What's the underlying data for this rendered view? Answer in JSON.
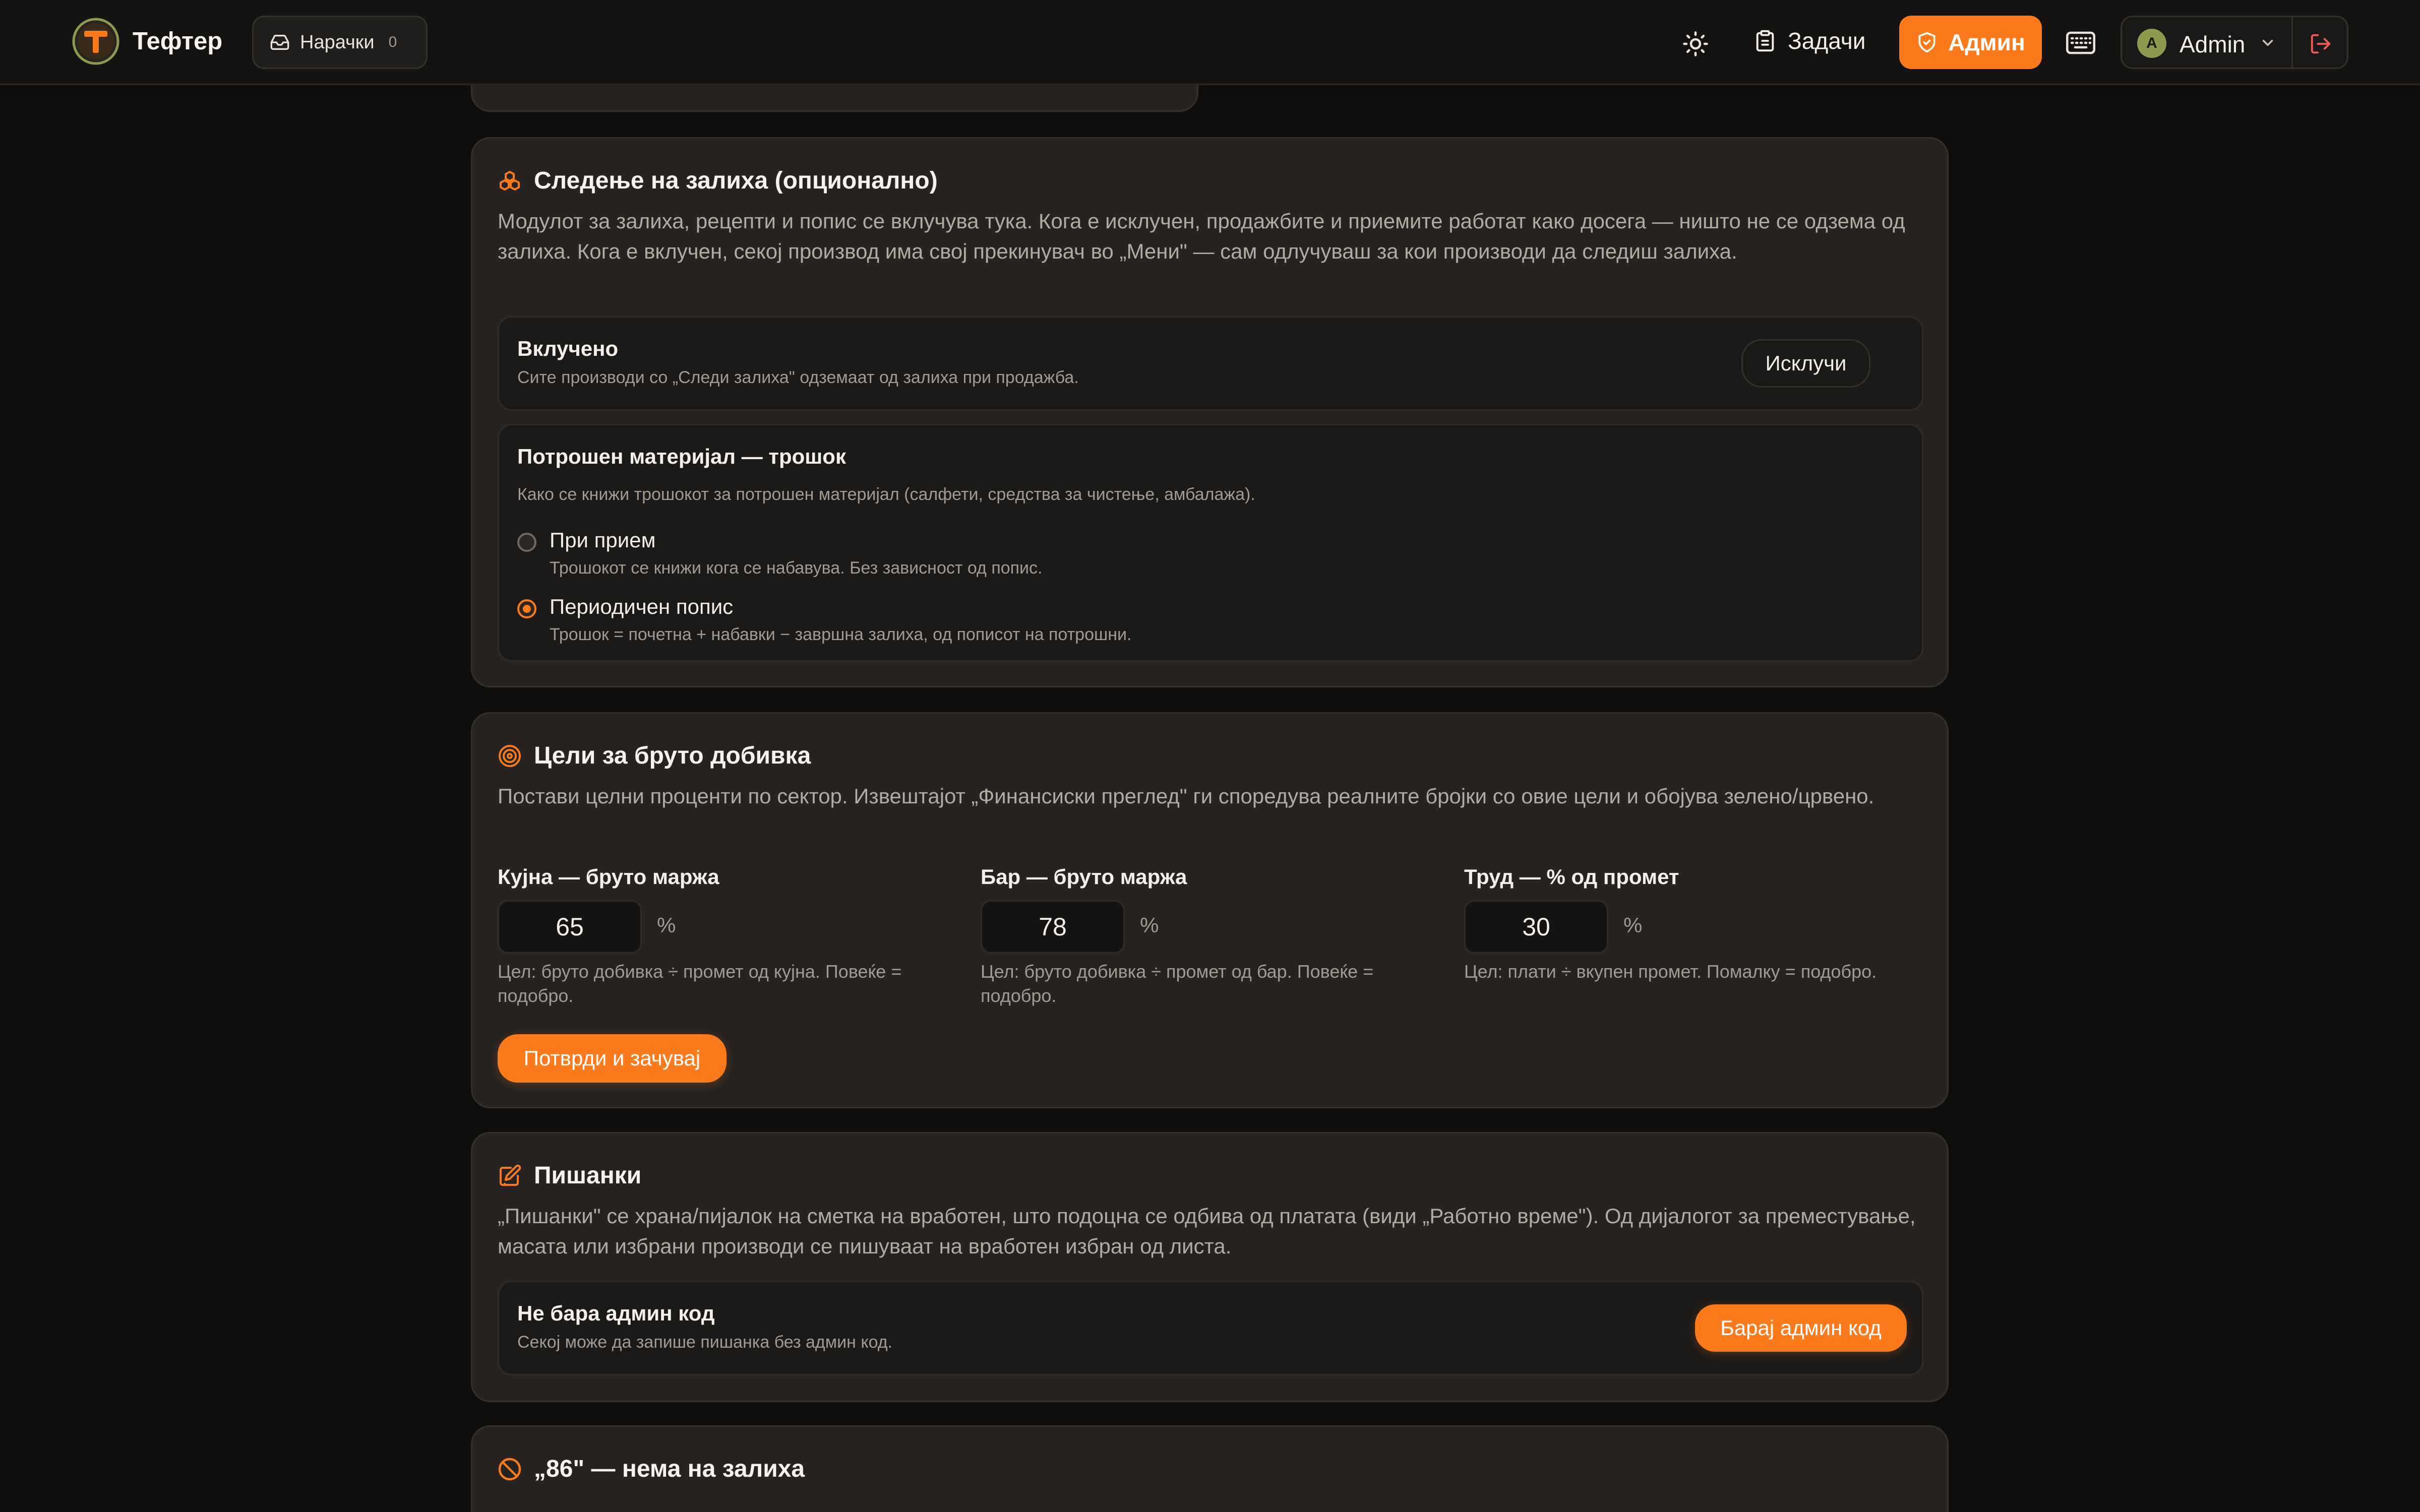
{
  "colors": {
    "accent": "#fb7a1c",
    "background": "#0f0e0d",
    "card": "#262320"
  },
  "header": {
    "brand": "Тефтер",
    "orders": {
      "label": "Нарачки",
      "count": "0",
      "icon": "inbox-icon"
    },
    "theme_icon": "sun-icon",
    "tasks": {
      "label": "Задачи",
      "icon": "clipboard-icon"
    },
    "admin": {
      "label": "Админ",
      "icon": "shield-icon"
    },
    "keyboard_icon": "keyboard-icon",
    "user": {
      "initial": "A",
      "name": "Admin"
    },
    "logout_icon": "logout-icon"
  },
  "stock": {
    "title": "Следење на залиха (опционално)",
    "icon": "boxes-icon",
    "description": "Модулот за залиха, рецепти и попис се вклучува тука. Кога е исклучен, продажбите и приемите работат како досега — ништо не се одзема од залиха. Кога е вклучен, секој производ има свој прекинувач во „Мени\" — сам одлучуваш за кои производи да следиш залиха.",
    "enabled": {
      "title": "Вклучено",
      "description": "Сите производи со „Следи залиха\" одземаат од залиха при продажба.",
      "button": "Исклучи"
    },
    "consumables": {
      "title": "Потрошен материјал — трошок",
      "description": "Како се книжи трошокот за потрошен материјал (салфети, средства за чистење, амбалажа).",
      "options": [
        {
          "label": "При прием",
          "description": "Трошокот се книжи кога се набавува. Без зависност од попис.",
          "selected": false
        },
        {
          "label": "Периодичен попис",
          "description": "Трошок = почетна + набавки − завршна залиха, од пописот на потрошни.",
          "selected": true
        }
      ]
    }
  },
  "targets": {
    "title": "Цели за бруто добивка",
    "icon": "target-icon",
    "description": "Постави целни проценти по сектор. Извештајот „Финансиски преглед\" ги споредува реалните бројки со овие цели и обојува зелено/црвено.",
    "fields": [
      {
        "label": "Кујна — бруто маржа",
        "value": "65",
        "unit": "%",
        "hint": "Цел: бруто добивка ÷ промет од кујна. Повеќе = подобро."
      },
      {
        "label": "Бар — бруто маржа",
        "value": "78",
        "unit": "%",
        "hint": "Цел: бруто добивка ÷ промет од бар. Повеќе = подобро."
      },
      {
        "label": "Труд — % од промет",
        "value": "30",
        "unit": "%",
        "hint": "Цел: плати ÷ вкупен промет. Помалку = подобро."
      }
    ],
    "save_button": "Потврди и зачувај"
  },
  "tabs": {
    "title": "Пишанки",
    "icon": "edit-note-icon",
    "description": "„Пишанки\" се храна/пијалок на сметка на вработен, што подоцна се одбива од платата (види „Работно време\"). Од дијалогот за преместување, масата или избрани производи се пишуваат на вработен избран од листа.",
    "setting": {
      "title": "Не бара админ код",
      "description": "Секој може да запише пишанка без админ код.",
      "button": "Барај админ код"
    },
    "threshold": "0.82"
  },
  "eighty_six": {
    "title": "„86\" — нема на залиха",
    "icon": "ban-icon"
  }
}
